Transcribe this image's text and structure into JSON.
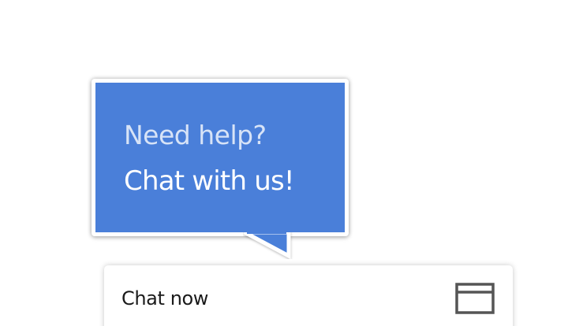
{
  "bubble": {
    "line1": "Need help?",
    "line2": "Chat with us!",
    "background_color": "#4a7fd9",
    "border_color": "#ffffff"
  },
  "chat_bar": {
    "label": "Chat now",
    "icon": "window-icon"
  }
}
